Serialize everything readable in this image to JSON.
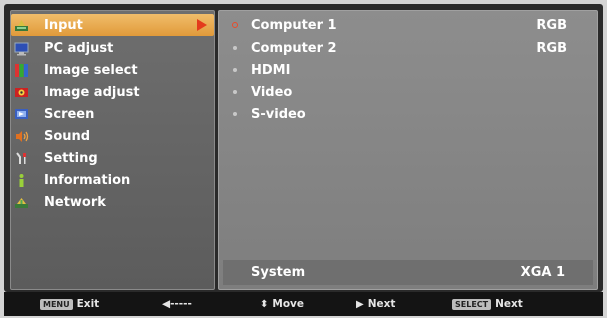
{
  "menu": {
    "items": [
      {
        "label": "Input",
        "icon": "input-icon",
        "selected": true
      },
      {
        "label": "PC adjust",
        "icon": "pc-adjust-icon"
      },
      {
        "label": "Image select",
        "icon": "image-select-icon"
      },
      {
        "label": "Image adjust",
        "icon": "image-adjust-icon"
      },
      {
        "label": "Screen",
        "icon": "screen-icon"
      },
      {
        "label": "Sound",
        "icon": "sound-icon"
      },
      {
        "label": "Setting",
        "icon": "setting-icon"
      },
      {
        "label": "Information",
        "icon": "information-icon"
      },
      {
        "label": "Network",
        "icon": "network-icon"
      }
    ]
  },
  "sources": {
    "items": [
      {
        "label": "Computer 1",
        "type": "RGB",
        "active": true
      },
      {
        "label": "Computer 2",
        "type": "RGB"
      },
      {
        "label": "HDMI",
        "type": ""
      },
      {
        "label": "Video",
        "type": ""
      },
      {
        "label": "S-video",
        "type": ""
      }
    ]
  },
  "system": {
    "label": "System",
    "value": "XGA 1"
  },
  "footer": {
    "exit_key": "MENU",
    "exit_label": "Exit",
    "back_label": "◀-----",
    "move_label": "Move",
    "next_label": "Next",
    "select_key": "SELECT",
    "select_label": "Next"
  },
  "colors": {
    "selected_highlight": "#e8a64a",
    "arrow": "#e43b1c",
    "active_dot": "#e84b2a"
  }
}
